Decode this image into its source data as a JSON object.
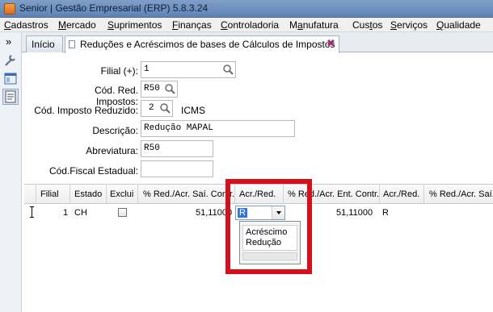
{
  "window": {
    "title": "Senior | Gestão Empresarial (ERP) 5.8.3.24"
  },
  "menu": [
    {
      "label": "Cadastros",
      "key": "C"
    },
    {
      "label": "Mercado",
      "key": "M"
    },
    {
      "label": "Suprimentos",
      "key": "S"
    },
    {
      "label": "Finanças",
      "key": "F"
    },
    {
      "label": "Controladoria",
      "key": "C"
    },
    {
      "label": "Manufatura",
      "key": "a"
    },
    {
      "label": "Custos",
      "key": "t"
    },
    {
      "label": "Serviços",
      "key": "S"
    },
    {
      "label": "Qualidade",
      "key": "Q"
    }
  ],
  "leftbar": {
    "expand": "»",
    "icons": [
      "wrench-icon",
      "window-icon",
      "notes-icon"
    ]
  },
  "tabs": {
    "home": "Início",
    "active": "Reduções e Acréscimos de bases de Cálculos de Impostos",
    "close": "✖"
  },
  "form": {
    "filial_label": "Filial (+):",
    "filial_value": "1",
    "cod_red_label": "Cód. Red. Impostos:",
    "cod_red_value": "R50",
    "cod_imp_label": "Cód. Imposto Reduzido:",
    "cod_imp_value": "2",
    "cod_imp_desc": "ICMS",
    "descricao_label": "Descrição:",
    "descricao_value": "Redução MAPAL",
    "abrev_label": "Abreviatura:",
    "abrev_value": "R50",
    "cod_fiscal_label": "Cód.Fiscal Estadual:",
    "cod_fiscal_value": ""
  },
  "grid": {
    "columns": [
      "Filial",
      "Estado",
      "Exclui",
      "% Red./Acr. Saí. Contr.",
      "Acr./Red.",
      "% Red./Acr. Ent. Contr.",
      "Acr./Red.",
      "% Red./Acr. Saí."
    ],
    "rows": [
      {
        "filial": "1",
        "estado": "CH",
        "exclui": false,
        "red_sai": "51,11000",
        "acr_red_sai": "R",
        "red_ent": "51,11000",
        "acr_red_ent": "R"
      }
    ]
  },
  "dropdown": {
    "options": [
      "Acréscimo",
      "Redução"
    ]
  },
  "colors": {
    "highlight": "#d40f1e",
    "titlebar": "#6f91c0",
    "selection": "#3478d4"
  }
}
